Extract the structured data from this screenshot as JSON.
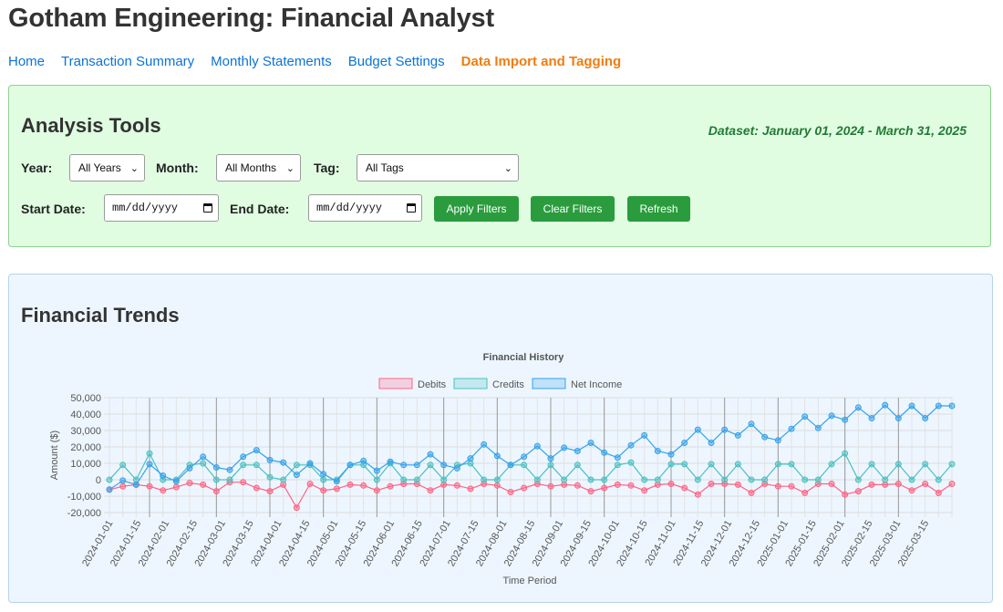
{
  "page_title": "Gotham Engineering: Financial Analyst",
  "nav": [
    {
      "label": "Home",
      "active": false
    },
    {
      "label": "Transaction Summary",
      "active": false
    },
    {
      "label": "Monthly Statements",
      "active": false
    },
    {
      "label": "Budget Settings",
      "active": false
    },
    {
      "label": "Data Import and Tagging",
      "active": true
    }
  ],
  "tools": {
    "title": "Analysis Tools",
    "dataset": "Dataset: January 01, 2024 - March 31, 2025",
    "year_label": "Year:",
    "year_value": "All Years",
    "month_label": "Month:",
    "month_value": "All Months",
    "tag_label": "Tag:",
    "tag_value": "All Tags",
    "start_label": "Start Date:",
    "start_placeholder": "mm/dd/yyyy",
    "end_label": "End Date:",
    "end_placeholder": "mm/dd/yyyy",
    "apply_label": "Apply Filters",
    "clear_label": "Clear Filters",
    "refresh_label": "Refresh"
  },
  "trends": {
    "title": "Financial Trends"
  },
  "colors": {
    "debits": "#ff6384",
    "credits": "#4bc0c0",
    "net_income": "#36a2eb",
    "button": "#2a9c3d",
    "nav_link": "#0b73d6",
    "nav_active": "#f07d0f"
  },
  "chart_data": {
    "type": "line",
    "title": "Financial History",
    "xlabel": "Time Period",
    "ylabel": "Amount ($)",
    "ylim": [
      -20000,
      50000
    ],
    "yticks": [
      -20000,
      -10000,
      0,
      10000,
      20000,
      30000,
      40000,
      50000
    ],
    "ytick_labels": [
      "-20,000",
      "-10,000",
      "0",
      "10,000",
      "20,000",
      "30,000",
      "40,000",
      "50,000"
    ],
    "legend_position": "top",
    "grid": true,
    "x_tick_labels": [
      "2024-01-01",
      "2024-01-15",
      "2024-02-01",
      "2024-02-15",
      "2024-03-01",
      "2024-03-15",
      "2024-04-01",
      "2024-04-15",
      "2024-05-01",
      "2024-05-15",
      "2024-06-01",
      "2024-06-15",
      "2024-07-01",
      "2024-07-15",
      "2024-08-01",
      "2024-08-15",
      "2024-09-01",
      "2024-09-15",
      "2024-10-01",
      "2024-10-15",
      "2024-11-01",
      "2024-11-15",
      "2024-12-01",
      "2024-12-15",
      "2025-01-01",
      "2025-01-15",
      "2025-02-01",
      "2025-02-15",
      "2025-03-01",
      "2025-03-15"
    ],
    "series": [
      {
        "name": "Debits",
        "values": [
          -6000,
          -4000,
          -3000,
          -4000,
          -6500,
          -4500,
          -2000,
          -3000,
          -7000,
          -1500,
          -1500,
          -5000,
          -7000,
          -3000,
          -17000,
          -2500,
          -6500,
          -5500,
          -3000,
          -3500,
          -6500,
          -4000,
          -2500,
          -2500,
          -6500,
          -3000,
          -3500,
          -5500,
          -2500,
          -3500,
          -7500,
          -5000,
          -2500,
          -4000,
          -3000,
          -3500,
          -7000,
          -5000,
          -3000,
          -3500,
          -6500,
          -3000,
          -2500,
          -5000,
          -9000,
          -2500,
          -2500,
          -3000,
          -8000,
          -2500,
          -4000,
          -4000,
          -8000,
          -2500,
          -2500,
          -9000,
          -7000,
          -3000,
          -3000,
          -2500,
          -6500,
          -2500,
          -8000,
          -2500
        ]
      },
      {
        "name": "Credits",
        "values": [
          0,
          9000,
          0,
          16000,
          0,
          0,
          9000,
          10000,
          0,
          0,
          9000,
          9000,
          1500,
          0,
          9000,
          9000,
          0,
          0,
          9000,
          9000,
          0,
          10000,
          0,
          0,
          9000,
          0,
          9000,
          10000,
          0,
          0,
          9000,
          9000,
          0,
          9000,
          0,
          9000,
          0,
          0,
          9000,
          10500,
          0,
          0,
          9500,
          9500,
          0,
          9500,
          0,
          9500,
          0,
          0,
          9500,
          9500,
          0,
          0,
          9500,
          16000,
          0,
          9500,
          0,
          9500,
          0,
          9500,
          0,
          9500
        ]
      },
      {
        "name": "Net Income",
        "values": [
          -6000,
          -500,
          -3000,
          9500,
          2500,
          -1000,
          7000,
          14000,
          7500,
          6000,
          14000,
          18000,
          12000,
          10500,
          3000,
          10000,
          3500,
          -1000,
          9000,
          11500,
          5500,
          11000,
          9000,
          9000,
          15500,
          9000,
          7000,
          13000,
          21500,
          14500,
          9000,
          14000,
          20500,
          13000,
          19500,
          17500,
          22500,
          16500,
          13500,
          21000,
          27000,
          17500,
          15500,
          22500,
          30500,
          22500,
          30500,
          27000,
          34000,
          26000,
          24000,
          31000,
          38500,
          31500,
          39000,
          36500,
          44000,
          37500,
          45500,
          37500,
          45000,
          37500,
          45000,
          45000
        ]
      }
    ]
  }
}
